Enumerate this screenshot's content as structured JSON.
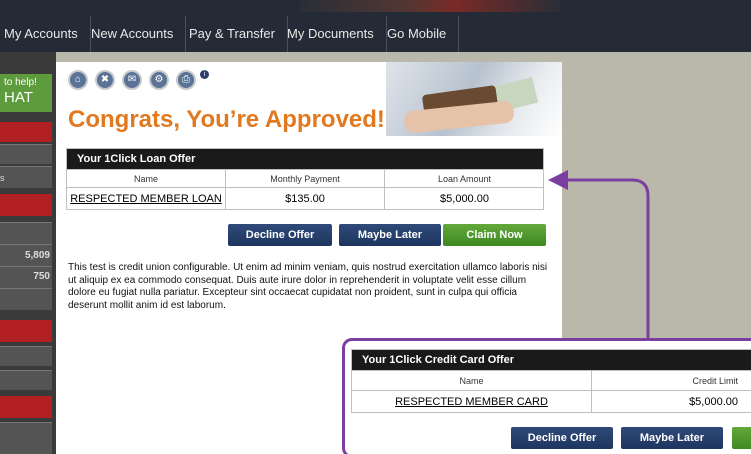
{
  "nav": {
    "items": [
      "My Accounts",
      "New Accounts",
      "Pay & Transfer",
      "My Documents",
      "Go Mobile"
    ]
  },
  "sidebar": {
    "chat_line1": "to help!",
    "chat_line2": "HAT",
    "partial_label": "s",
    "num1": "5,809",
    "num2": "750"
  },
  "icons": [
    "home-icon",
    "tools-icon",
    "mail-icon",
    "gear-icon",
    "print-icon",
    "info-icon"
  ],
  "page": {
    "title": "Congrats, You’re Approved!",
    "body": "This test is credit union configurable. Ut enim ad minim veniam, quis nostrud exercitation ullamco laboris nisi ut aliquip ex ea commodo consequat. Duis aute irure dolor in reprehenderit in voluptate velit esse cillum dolore eu fugiat nulla pariatur. Excepteur sint occaecat cupidatat non proident, sunt in culpa qui officia deserunt mollit anim id est laborum."
  },
  "loan_offer": {
    "heading": "Your 1Click Loan Offer",
    "col_name": "Name",
    "col_payment": "Monthly Payment",
    "col_amount": "Loan Amount",
    "name": "RESPECTED MEMBER LOAN",
    "payment": "$135.00",
    "amount": "$5,000.00",
    "decline": "Decline Offer",
    "maybe": "Maybe Later",
    "claim": "Claim Now"
  },
  "card_offer": {
    "heading": "Your 1Click Credit Card Offer",
    "col_name": "Name",
    "col_limit": "Credit Limit",
    "name": "RESPECTED MEMBER CARD",
    "limit": "$5,000.00",
    "decline": "Decline Offer",
    "maybe": "Maybe Later"
  },
  "colors": {
    "accent_orange": "#e2791f",
    "button_blue": "#1e3560",
    "button_green": "#3f8a23",
    "highlight_purple": "#7b3fa0"
  }
}
